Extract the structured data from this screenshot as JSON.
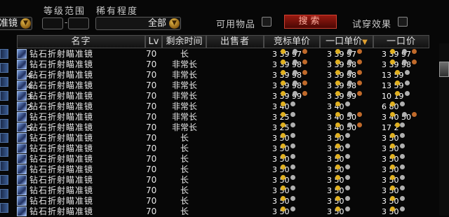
{
  "filters": {
    "level_label": "等级范围",
    "rarity_label": "稀有程度",
    "category_value": "准镜",
    "rarity_value": "全部",
    "usable_label": "可用物品",
    "search_label": "搜索",
    "tryon_label": "试穿效果",
    "level_separator": "-"
  },
  "headers": {
    "name": "名字",
    "lv": "Lv",
    "time": "剩余时间",
    "seller": "出售者",
    "bid": "竞标单价",
    "buyout_unit": "一口单价",
    "buyout": "一口价"
  },
  "colors": {
    "gold": "#e0b020",
    "silver": "#b0b0b0",
    "copper": "#c06a2a",
    "search_red": "#9a1a10"
  },
  "rows": [
    {
      "qty": "",
      "name": "钻石折射瞄准镜",
      "lv": "70",
      "time": "长",
      "seller": "",
      "bid": "3 ●39 ●97 ●",
      "unit": "3 ●39 ●97 ●",
      "buyout": "3 ●39 ●97 ●"
    },
    {
      "qty": "",
      "name": "钻石折射瞄准镜",
      "lv": "70",
      "time": "非常长",
      "seller": "",
      "bid": "3 ●39 ●98 ●",
      "unit": "3 ●39 ●98 ●",
      "buyout": "3 ●39 ●98 ●"
    },
    {
      "qty": "4",
      "name": "钻石折射瞄准镜",
      "lv": "70",
      "time": "非常长",
      "seller": "",
      "bid": "3 ●39 ●98 ●",
      "unit": "3 ●39 ●98 ●",
      "buyout": "13 ●59 ●"
    },
    {
      "qty": "4",
      "name": "钻石折射瞄准镜",
      "lv": "70",
      "time": "非常长",
      "seller": "",
      "bid": "3 ●39 ●98 ●",
      "unit": "3 ●39 ●98 ●",
      "buyout": "13 ●59 ●"
    },
    {
      "qty": "3",
      "name": "钻石折射瞄准镜",
      "lv": "70",
      "time": "非常长",
      "seller": "",
      "bid": "3 ●39 ●99 ●",
      "unit": "3 ●39 ●99 ●",
      "buyout": "10 ●19 ●"
    },
    {
      "qty": "2",
      "name": "钻石折射瞄准镜",
      "lv": "70",
      "time": "非常长",
      "seller": "",
      "bid": "3 ●40 ●",
      "unit": "3 ●40 ●",
      "buyout": "6 ●80 ●"
    },
    {
      "qty": "",
      "name": "钻石折射瞄准镜",
      "lv": "70",
      "time": "非常长",
      "seller": "",
      "bid": "3 ●25 ●",
      "unit": "3 ●40 ●50 ●",
      "buyout": "3 ●40 ●50 ●"
    },
    {
      "qty": "5",
      "name": "钻石折射瞄准镜",
      "lv": "70",
      "time": "非常长",
      "seller": "",
      "bid": "3 ●25 ●",
      "unit": "3 ●40 ●50 ●",
      "buyout": "17 ●2 ●"
    },
    {
      "qty": "",
      "name": "钻石折射瞄准镜",
      "lv": "70",
      "time": "长",
      "seller": "",
      "bid": "3 ●50 ●",
      "unit": "3 ●50 ●",
      "buyout": "3 ●50 ●"
    },
    {
      "qty": "",
      "name": "钻石折射瞄准镜",
      "lv": "70",
      "time": "长",
      "seller": "",
      "bid": "3 ●50 ●",
      "unit": "3 ●50 ●",
      "buyout": "3 ●50 ●"
    },
    {
      "qty": "",
      "name": "钻石折射瞄准镜",
      "lv": "70",
      "time": "长",
      "seller": "",
      "bid": "3 ●50 ●",
      "unit": "3 ●50 ●",
      "buyout": "3 ●50 ●"
    },
    {
      "qty": "",
      "name": "钻石折射瞄准镜",
      "lv": "70",
      "time": "长",
      "seller": "",
      "bid": "3 ●50 ●",
      "unit": "3 ●50 ●",
      "buyout": "3 ●50 ●"
    },
    {
      "qty": "",
      "name": "钻石折射瞄准镜",
      "lv": "70",
      "time": "长",
      "seller": "",
      "bid": "3 ●50 ●",
      "unit": "3 ●50 ●",
      "buyout": "3 ●50 ●"
    },
    {
      "qty": "",
      "name": "钻石折射瞄准镜",
      "lv": "70",
      "time": "长",
      "seller": "",
      "bid": "3 ●50 ●",
      "unit": "3 ●50 ●",
      "buyout": "3 ●50 ●"
    },
    {
      "qty": "",
      "name": "钻石折射瞄准镜",
      "lv": "70",
      "time": "长",
      "seller": "",
      "bid": "3 ●50 ●",
      "unit": "3 ●50 ●",
      "buyout": "3 ●50 ●"
    },
    {
      "qty": "",
      "name": "钻石折射瞄准镜",
      "lv": "70",
      "time": "长",
      "seller": "",
      "bid": "3 ●50 ●",
      "unit": "3 ●50 ●",
      "buyout": "3 ●50 ●"
    }
  ]
}
